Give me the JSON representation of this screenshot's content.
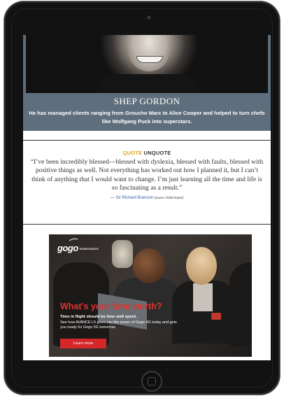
{
  "hero": {
    "name": "SHEP GORDON",
    "description": "He has managed clients ranging from Groucho Marx to Alice Cooper and helped to turn chefs like Wolfgang Puck into superstars."
  },
  "quote": {
    "heading_accent": "QUOTE",
    "heading_plain": "UNQUOTE",
    "text": "“I’ve been incredibly blessed—blessed with dyslexia, blessed with faults, blessed with positive things as well. Not everything has worked out how I planned it, but I can’t think of anything that I would want to change. I’m just learning all the time and life is so fascinating as a result.”",
    "dash": "—",
    "author": "Sir Richard Branson",
    "source": "(source: Robb Report)"
  },
  "ad": {
    "logo": "gogo",
    "logo_sub": "BUSINESS AVIATION",
    "headline": "What’s your time worth?",
    "subhead": "Time in flight should be time well spent.",
    "body": "See how AVANCE L5 gives you the power of Gogo 4G today and gets you ready for Gogo 5G tomorrow",
    "cta": "Learn more"
  },
  "colors": {
    "caption_bg": "#5e6e7c",
    "quote_accent": "#e3a21a",
    "author_link": "#3a63a8",
    "ad_red": "#d5272a"
  }
}
